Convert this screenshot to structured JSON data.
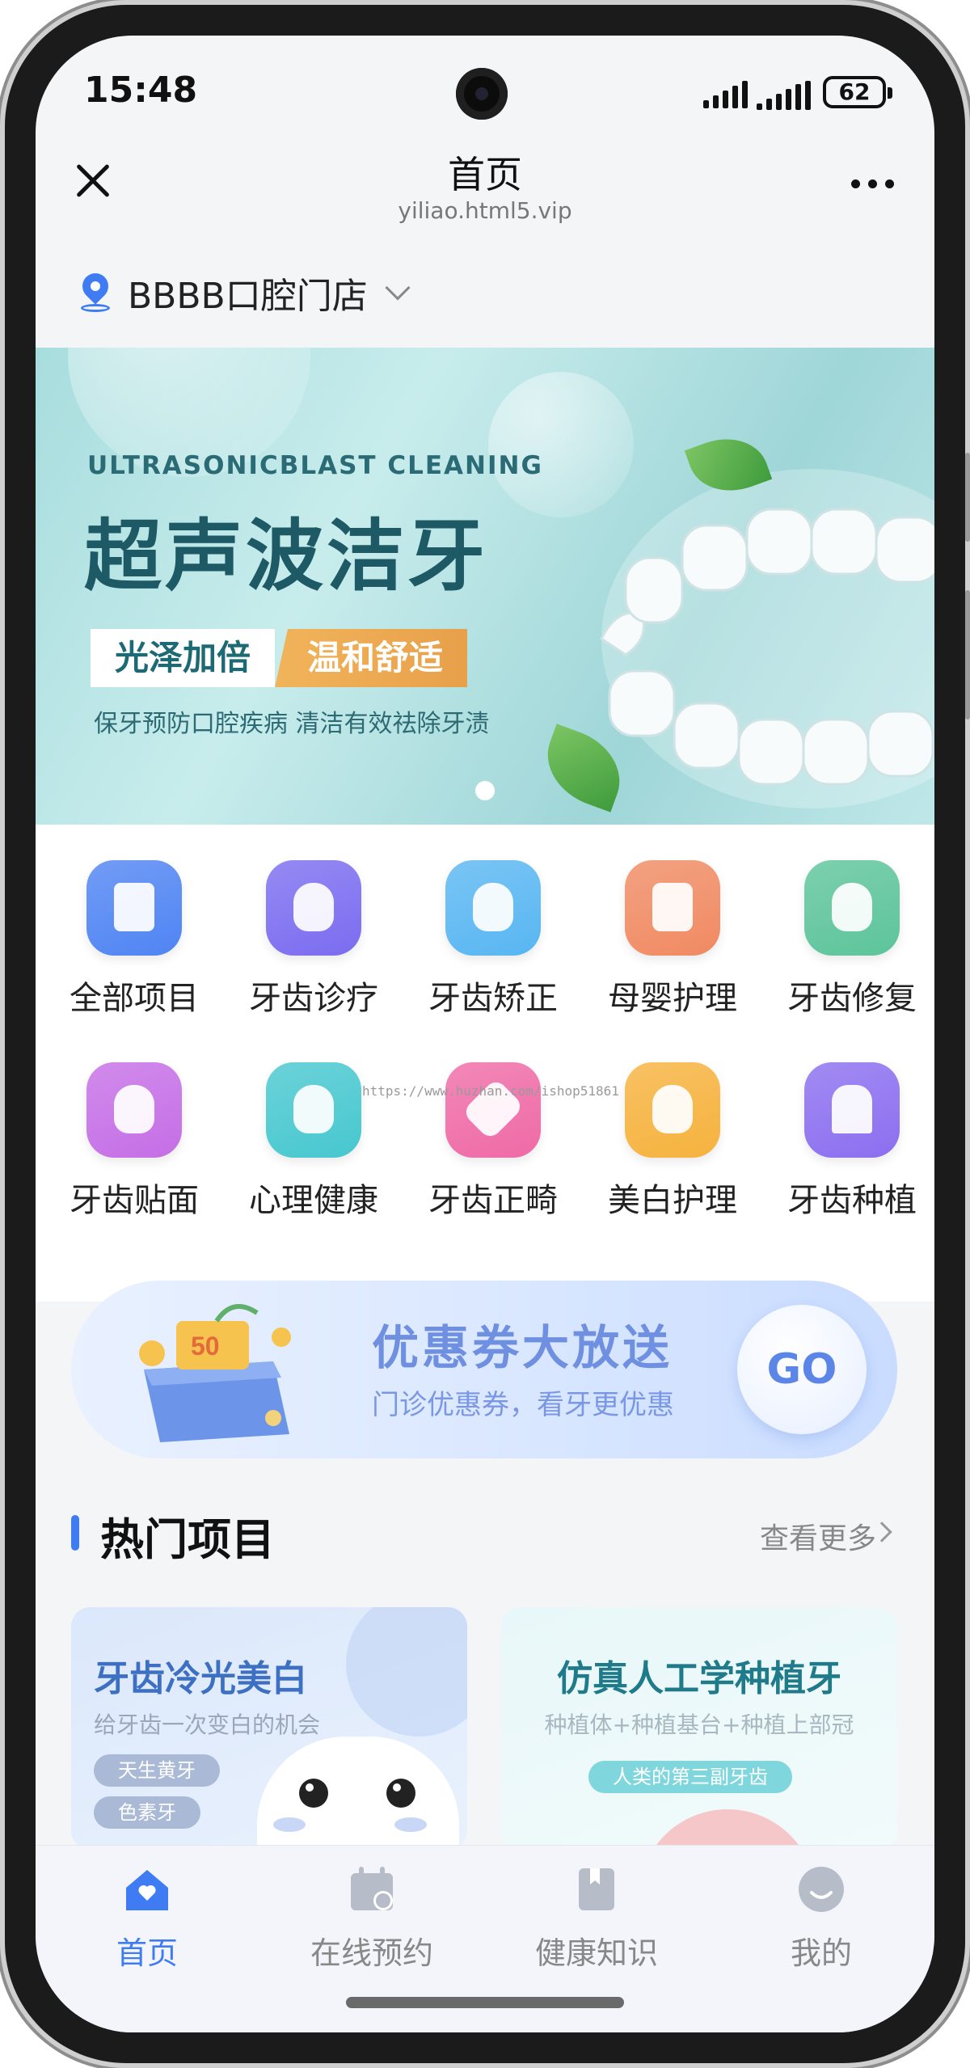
{
  "status_bar": {
    "time": "15:48",
    "battery": "62"
  },
  "title_bar": {
    "title": "首页",
    "url": "yiliao.html5.vip"
  },
  "location": {
    "store_name": "BBBB口腔门店"
  },
  "banner": {
    "subtitle_en": "ULTRASONICBLAST CLEANING",
    "title": "超声波洁牙",
    "tag_1": "光泽加倍",
    "tag_2": "温和舒适",
    "description": "保牙预防口腔疾病  清洁有效祛除牙渍"
  },
  "categories": [
    {
      "label": "全部项目",
      "color": "#4f84f3",
      "icon": "document-icon"
    },
    {
      "label": "牙齿诊疗",
      "color": "#7b6cf0",
      "icon": "tooth-plus-icon"
    },
    {
      "label": "牙齿矫正",
      "color": "#58b6f2",
      "icon": "braces-icon"
    },
    {
      "label": "母婴护理",
      "color": "#f08a62",
      "icon": "crib-icon"
    },
    {
      "label": "牙齿修复",
      "color": "#5cc49a",
      "icon": "tooth-search-icon"
    },
    {
      "label": "牙齿贴面",
      "color": "#c56ee6",
      "icon": "tooth-icon"
    },
    {
      "label": "心理健康",
      "color": "#47c7cf",
      "icon": "tooth-heart-icon"
    },
    {
      "label": "牙齿正畸",
      "color": "#ef6aa6",
      "icon": "bandage-icon"
    },
    {
      "label": "美白护理",
      "color": "#f6b23d",
      "icon": "sparkle-tooth-icon"
    },
    {
      "label": "牙齿种植",
      "color": "#8b6ef0",
      "icon": "implant-icon"
    }
  ],
  "watermark": "https://www.huzhan.com/ishop51861",
  "coupon": {
    "title": "优惠券大放送",
    "subtitle": "门诊优惠券，看牙更优惠",
    "button": "GO",
    "gift_value": "50"
  },
  "hot": {
    "title": "热门项目",
    "see_more": "查看更多",
    "cards": [
      {
        "title": "牙齿冷光美白",
        "subtitle": "给牙齿一次变白的机会",
        "tags": [
          "天生黄牙",
          "色素牙"
        ]
      },
      {
        "title": "仿真人工学种植牙",
        "subtitle": "种植体+种植基台+种植上部冠",
        "tags": [
          "人类的第三副牙齿"
        ]
      }
    ]
  },
  "tabs": [
    {
      "label": "首页",
      "active": true
    },
    {
      "label": "在线预约",
      "active": false
    },
    {
      "label": "健康知识",
      "active": false
    },
    {
      "label": "我的",
      "active": false
    }
  ],
  "colors": {
    "accent": "#3f7cf4",
    "banner_title": "#1d5a66",
    "coupon_text": "#6f8fe0"
  }
}
